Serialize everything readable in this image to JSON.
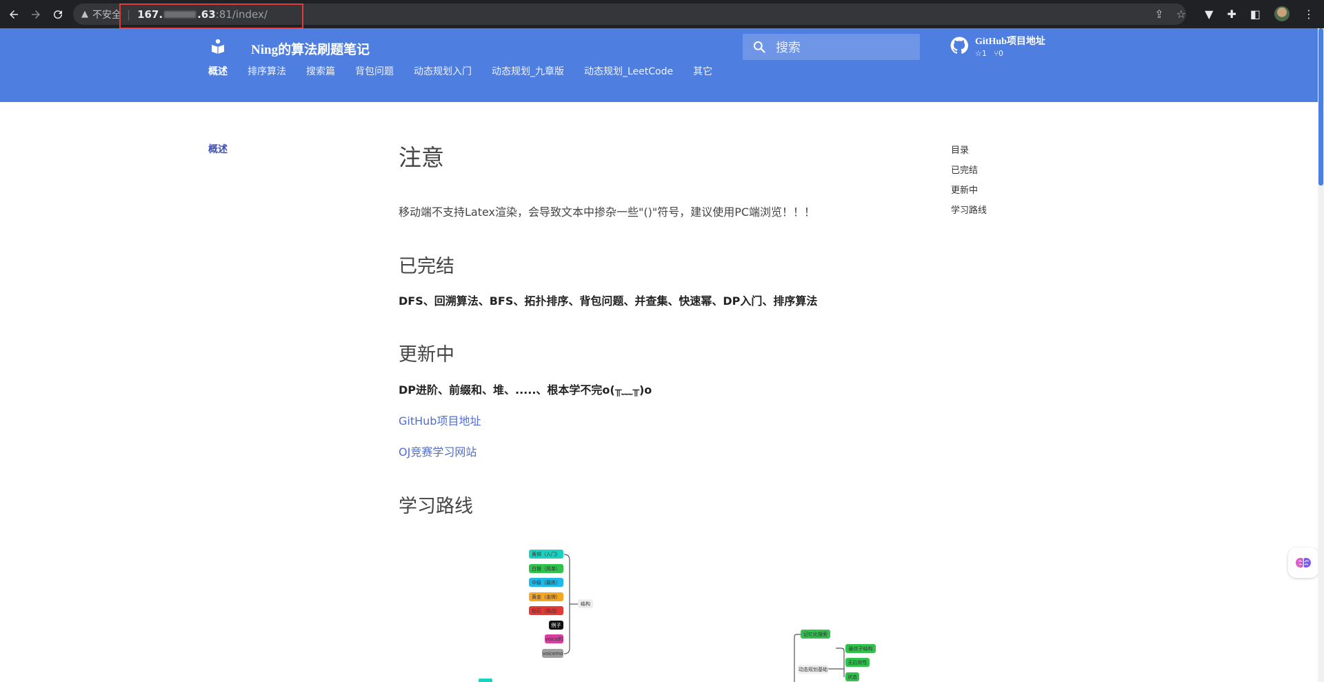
{
  "browser": {
    "insecure_label": "不安全",
    "url_host_prefix": "167.",
    "url_host_suffix": ".63",
    "url_path": ":81/index/"
  },
  "header": {
    "site_title": "Ning的算法刷题笔记",
    "search_placeholder": "搜索",
    "github": {
      "name": "GitHub项目地址",
      "stars": "☆1",
      "forks": "⑂0"
    },
    "tabs": [
      "概述",
      "排序算法",
      "搜索篇",
      "背包问题",
      "动态规划入门",
      "动态规划_九章版",
      "动态规划_LeetCode",
      "其它"
    ]
  },
  "leftnav": {
    "item": "概述"
  },
  "content": {
    "title": "注意",
    "note": "移动端不支持Latex渲染，会导致文本中掺杂一些\"()\"符号，建议使用PC端浏览！！！",
    "done_heading": "已完结",
    "done_text": "DFS、回溯算法、BFS、拓扑排序、背包问题、并查集、快速幂、DP入门、排序算法",
    "updating_heading": "更新中",
    "updating_text": "DP进阶、前缀和、堆、.....、根本学不完o(╥﹏╥)o",
    "link_github": "GitHub项目地址",
    "link_oj": "OJ竞赛学习网站",
    "route_heading": "学习路线"
  },
  "toc": {
    "title": "目录",
    "items": [
      "已完结",
      "更新中",
      "学习路线"
    ]
  },
  "mindmap": {
    "left": [
      {
        "label": "黄铜（入门）",
        "color": "#19d3c0"
      },
      {
        "label": "白银（简单）",
        "color": "#30c24c"
      },
      {
        "label": "中级（磨炼）",
        "color": "#20b8e6"
      },
      {
        "label": "黄金（金牌）",
        "color": "#f5a623"
      },
      {
        "label": "钻石（挑战）",
        "color": "#e53935"
      },
      {
        "label": "例子",
        "color": "#111111"
      },
      {
        "label": "voice的",
        "color": "#d63ea0"
      },
      {
        "label": "voicemo",
        "color": "#9e9e9e"
      }
    ],
    "left_root": "结构",
    "right_top": {
      "label": "记忆化搜索",
      "color": "#30c24c"
    },
    "right_root": "动态规划基础",
    "right": [
      {
        "label": "最优子结构",
        "color": "#30c24c"
      },
      {
        "label": "无后效性",
        "color": "#30c24c"
      },
      {
        "label": "状态",
        "color": "#30c24c"
      }
    ]
  }
}
